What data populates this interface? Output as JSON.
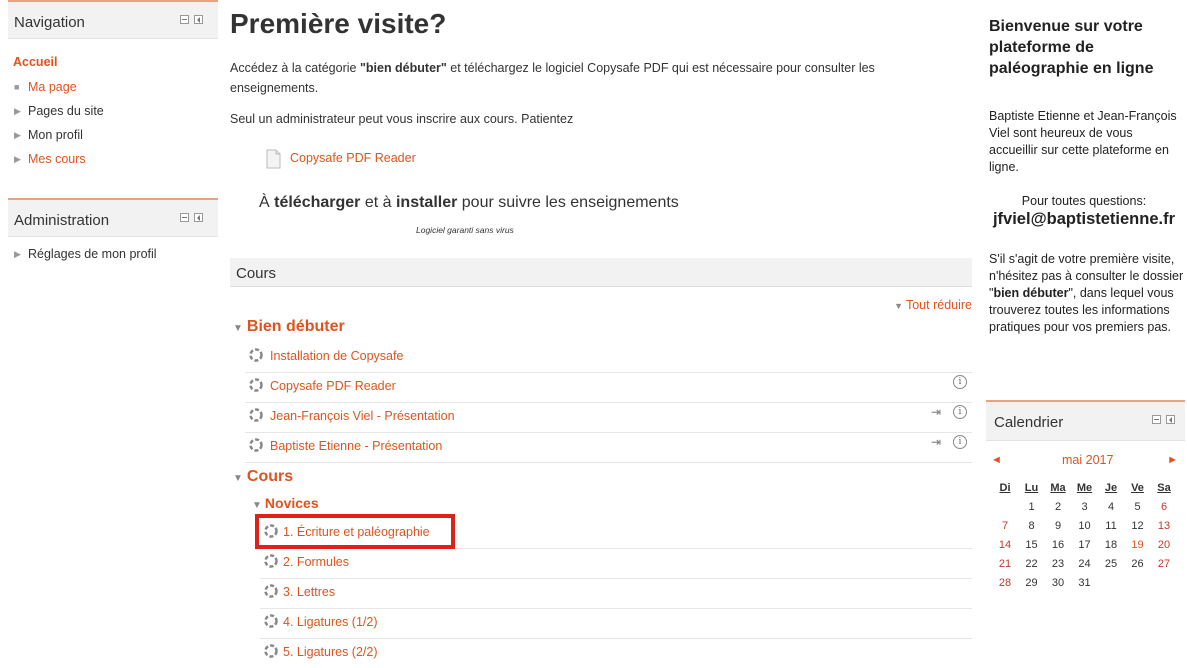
{
  "navigation": {
    "title": "Navigation",
    "home": "Accueil",
    "items": [
      {
        "label": "Ma page",
        "link": true,
        "icon": "bullet"
      },
      {
        "label": "Pages du site",
        "link": false,
        "icon": "caret"
      },
      {
        "label": "Mon profil",
        "link": false,
        "icon": "caret"
      },
      {
        "label": "Mes cours",
        "link": true,
        "icon": "caret"
      }
    ]
  },
  "administration": {
    "title": "Administration",
    "items": [
      {
        "label": "Réglages de mon profil"
      }
    ]
  },
  "main": {
    "title": "Première visite?",
    "intro_before": "Accédez à la catégorie ",
    "intro_bold": "\"bien débuter\"",
    "intro_after": " et téléchargez le logiciel Copysafe PDF qui est nécessaire pour consulter les enseignements.",
    "intro2": "Seul un administrateur peut vous inscrire aux cours. Patientez",
    "resource_link": "Copysafe PDF Reader",
    "download_a": "À ",
    "download_b": "télécharger",
    "download_c": " et à ",
    "download_d": "installer",
    "download_e": " pour suivre les enseignements",
    "virus_note": "Logiciel garanti sans virus",
    "courses_header": "Cours",
    "collapse_all": "Tout réduire",
    "sections": [
      {
        "title": "Bien débuter",
        "items": [
          {
            "label": "Installation de Copysafe",
            "info": false,
            "enrol": false
          },
          {
            "label": "Copysafe PDF Reader",
            "info": true,
            "enrol": false
          },
          {
            "label": "Jean-François Viel - Présentation",
            "info": true,
            "enrol": true
          },
          {
            "label": "Baptiste Etienne - Présentation",
            "info": true,
            "enrol": true
          }
        ]
      },
      {
        "title": "Cours",
        "subsection": "Novices",
        "items": [
          {
            "label": "1. Écriture et paléographie"
          },
          {
            "label": "2. Formules"
          },
          {
            "label": "3. Lettres"
          },
          {
            "label": "4. Ligatures (1/2)"
          },
          {
            "label": "5. Ligatures (2/2)"
          }
        ]
      }
    ]
  },
  "sidebar_right": {
    "welcome_title": "Bienvenue sur votre plateforme de paléographie en ligne",
    "welcome_text": "Baptiste Etienne et Jean-François Viel sont heureux de vous accueillir sur cette plateforme en ligne.",
    "questions": "Pour toutes questions:",
    "email": "jfviel@baptistetienne.fr",
    "first_visit_a": "S'il s'agit de votre première visite, n'hésitez pas à consulter le dossier \"",
    "first_visit_bold": "bien débuter",
    "first_visit_b": "\", dans lequel vous trouverez toutes les informations pratiques pour vos premiers pas."
  },
  "calendar": {
    "title": "Calendrier",
    "month": "mai 2017",
    "prev": "◄",
    "next": "►",
    "weekdays": [
      "Di",
      "Lu",
      "Ma",
      "Me",
      "Je",
      "Ve",
      "Sa"
    ],
    "weeks": [
      [
        "",
        "1",
        "2",
        "3",
        "4",
        "5",
        "6"
      ],
      [
        "7",
        "8",
        "9",
        "10",
        "11",
        "12",
        "13"
      ],
      [
        "14",
        "15",
        "16",
        "17",
        "18",
        "19",
        "20"
      ],
      [
        "21",
        "22",
        "23",
        "24",
        "25",
        "26",
        "27"
      ],
      [
        "28",
        "29",
        "30",
        "31",
        "",
        "",
        ""
      ]
    ],
    "highlight_day": "19",
    "colors": {
      "weekend": "#c0392b",
      "accent": "#e0531e"
    }
  }
}
